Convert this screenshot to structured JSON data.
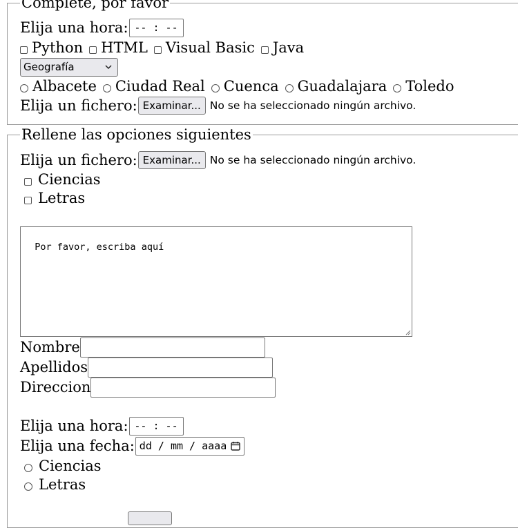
{
  "fieldset1": {
    "legend": "Complete, por favor",
    "time_label": "Elija una hora:",
    "time_placeholder": "-- : --",
    "languages": [
      "Python",
      "HTML",
      "Visual Basic",
      "Java"
    ],
    "select_value": "Geografía",
    "cities": [
      "Albacete",
      "Ciudad Real",
      "Cuenca",
      "Guadalajara",
      "Toledo"
    ],
    "file_label": "Elija un fichero:",
    "file_button": "Examinar...",
    "file_status": "No se ha seleccionado ningún archivo."
  },
  "fieldset2": {
    "legend": "Rellene las opciones siguientes",
    "file_label": "Elija un fichero:",
    "file_button": "Examinar...",
    "file_status": "No se ha seleccionado ningún archivo.",
    "checkboxes": [
      "Ciencias",
      "Letras"
    ],
    "textarea_value": "Por favor, escriba aquí",
    "name_label": "Nombre",
    "surname_label": "Apellidos",
    "address_label": "Direccion",
    "time_label": "Elija una hora:",
    "time_placeholder": "-- : --",
    "date_label": "Elija una fecha:",
    "date_placeholder": "dd / mm / aaaa",
    "radios": [
      "Ciencias",
      "Letras"
    ]
  },
  "icons": {
    "select_arrow": "chevron-down-icon",
    "calendar": "calendar-icon",
    "resize": "resize-grip-icon"
  }
}
